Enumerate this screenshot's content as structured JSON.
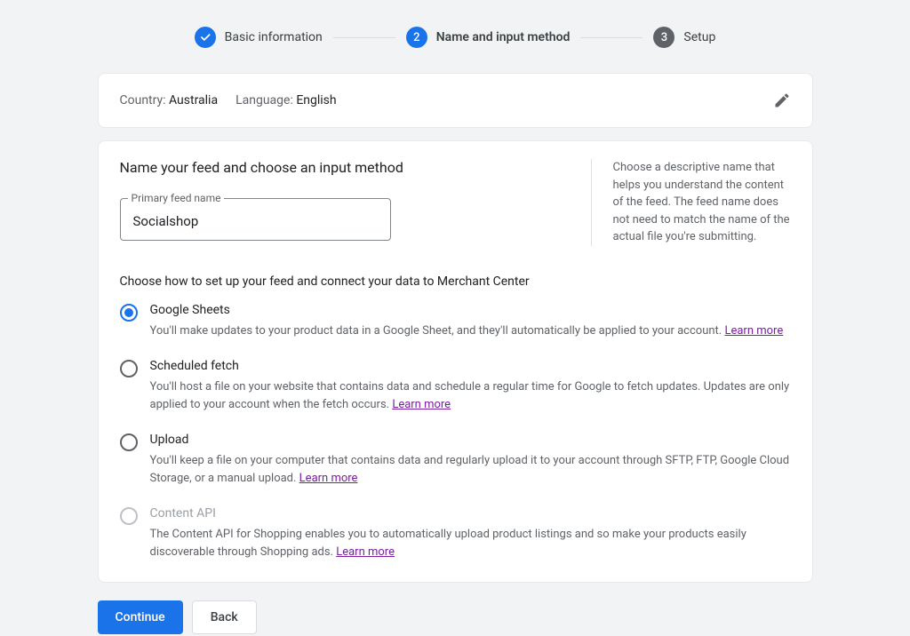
{
  "stepper": {
    "steps": [
      {
        "label": "Basic information",
        "state": "done"
      },
      {
        "label": "Name and input method",
        "num": "2",
        "state": "active"
      },
      {
        "label": "Setup",
        "num": "3",
        "state": "pending"
      }
    ]
  },
  "summary": {
    "country_label": "Country: ",
    "country_value": "Australia",
    "language_label": "Language: ",
    "language_value": "English"
  },
  "section_heading": "Name your feed and choose an input method",
  "input": {
    "legend": "Primary feed name",
    "value": "Socialshop"
  },
  "help_text": "Choose a descriptive name that helps you understand the content of the feed. The feed name does not need to match the name of the actual file you're submitting.",
  "subsection_heading": "Choose how to set up your feed and connect your data to Merchant Center",
  "options": [
    {
      "title": "Google Sheets",
      "desc": "You'll make updates to your product data in a Google Sheet, and they'll automatically be applied to your account. ",
      "learn": "Learn more",
      "selected": true
    },
    {
      "title": "Scheduled fetch",
      "desc": "You'll host a file on your website that contains data and schedule a regular time for Google to fetch updates. Updates are only applied to your account when the fetch occurs. ",
      "learn": "Learn more",
      "selected": false
    },
    {
      "title": "Upload",
      "desc": "You'll keep a file on your computer that contains data and regularly upload it to your account through SFTP, FTP, Google Cloud Storage, or a manual upload. ",
      "learn": "Learn more",
      "selected": false
    },
    {
      "title": "Content API",
      "desc": "The Content API for Shopping enables you to automatically upload product listings and so make your products easily discoverable through Shopping ads. ",
      "learn": "Learn more",
      "selected": false,
      "disabled": true
    }
  ],
  "buttons": {
    "continue": "Continue",
    "back": "Back"
  }
}
